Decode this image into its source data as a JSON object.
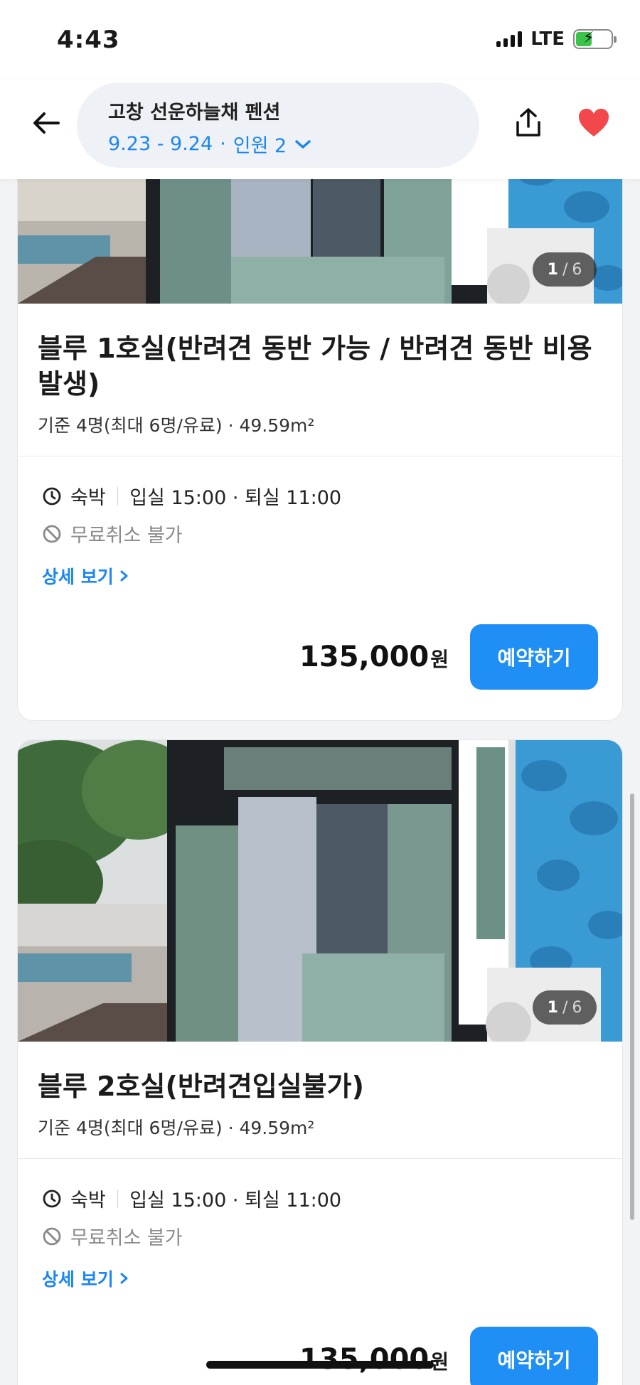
{
  "status": {
    "time": "4:43",
    "network": "LTE"
  },
  "header": {
    "title": "고창 선운하늘채 펜션",
    "dates": "9.23 - 9.24",
    "guests": "인원 2"
  },
  "rooms": [
    {
      "photo_counter": {
        "current": "1",
        "total": "6"
      },
      "title": "블루 1호실(반려견 동반 가능 / 반려견 동반 비용 발생)",
      "capacity": "기준 4명(최대 6명/유료) · 49.59m²",
      "stay_type": "숙박",
      "checkin": "입실 15:00 · 퇴실 11:00",
      "cancel": "무료취소 불가",
      "detail_link": "상세 보기",
      "price": "135,000",
      "currency": "원",
      "reserve_label": "예약하기"
    },
    {
      "photo_counter": {
        "current": "1",
        "total": "6"
      },
      "title": "블루 2호실(반려견입실불가)",
      "capacity": "기준 4명(최대 6명/유료) · 49.59m²",
      "stay_type": "숙박",
      "checkin": "입실 15:00 · 퇴실 11:00",
      "cancel": "무료취소 불가",
      "detail_link": "상세 보기",
      "price": "135,000",
      "currency": "원",
      "reserve_label": "예약하기"
    }
  ],
  "colors": {
    "accent": "#1f8ef5",
    "heart": "#f2484b",
    "stone": "#3a9bd4"
  }
}
